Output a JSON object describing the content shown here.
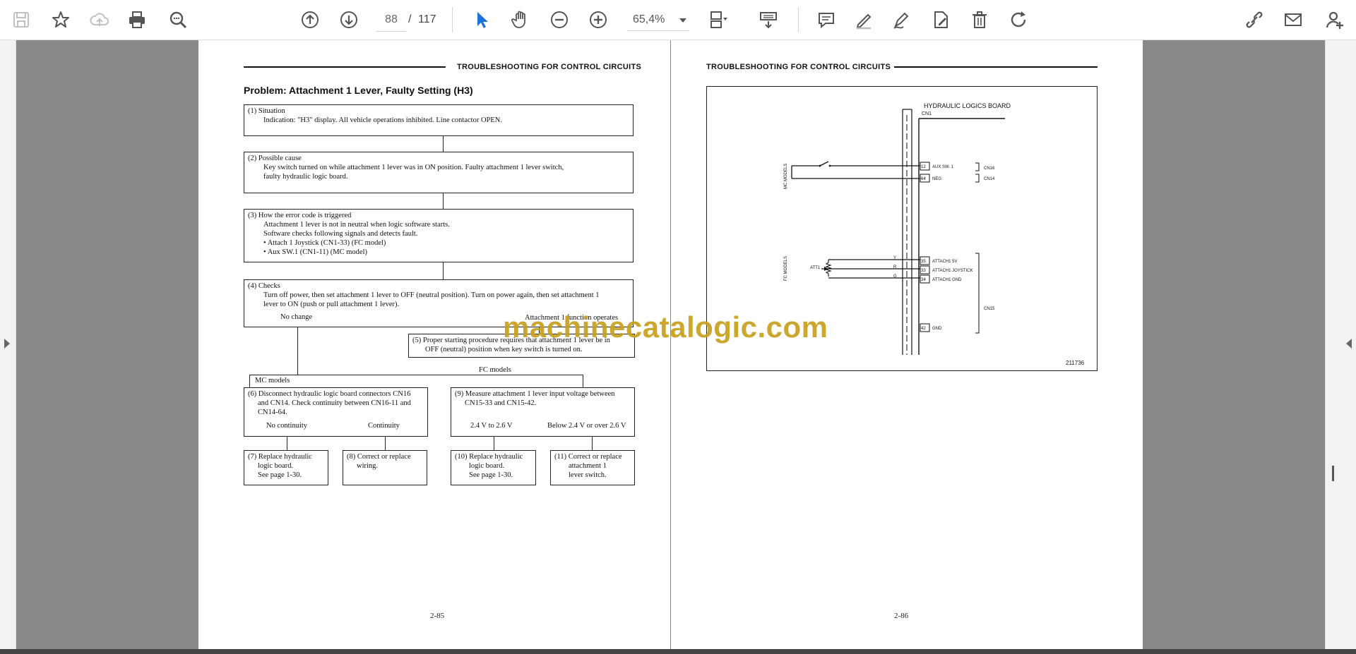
{
  "toolbar": {
    "page_current": "88",
    "page_separator": "/",
    "page_total": "117",
    "zoom": "65,4%",
    "icons": [
      "save-icon",
      "bookmark-star-icon",
      "cloud-upload-icon",
      "print-icon",
      "zoom-search-icon",
      "arrow-up-circle-icon",
      "arrow-down-circle-icon",
      "select-cursor-icon",
      "hand-pan-icon",
      "zoom-out-icon",
      "zoom-in-icon",
      "fit-page-icon",
      "scroll-mode-icon",
      "comment-icon",
      "highlight-pen-icon",
      "draw-pen-icon",
      "fill-sign-icon",
      "delete-icon",
      "rotate-icon",
      "share-link-icon",
      "mail-icon",
      "add-user-icon"
    ]
  },
  "left_page": {
    "header": "TROUBLESHOOTING FOR CONTROL CIRCUITS",
    "title": "Problem: Attachment 1 Lever, Faulty Setting (H3)",
    "box1_title": "(1) Situation",
    "box1_line1": "Indication: \"H3\" display. All vehicle operations inhibited. Line contactor OPEN.",
    "box2_title": "(2) Possible cause",
    "box2_line1": "Key switch turned on while attachment 1 lever was in ON position. Faulty attachment 1 lever switch,",
    "box2_line2": "faulty hydraulic logic board.",
    "box3_title": "(3) How the error code is triggered",
    "box3_line1": "Attachment 1 lever is not in neutral when logic software starts.",
    "box3_line2": "Software checks following signals and detects fault.",
    "box3_line3": "• Attach 1 Joystick (CN1-33) (FC model)",
    "box3_line4": "• Aux SW.1 (CN1-11) (MC model)",
    "box4_title": "(4) Checks",
    "box4_line1": "Turn off power, then set attachment 1 lever to OFF (neutral position). Turn on power again, then set attachment 1",
    "box4_line2": "lever to ON (push or pull attachment 1 lever).",
    "label_nochange": "No change",
    "label_attach_ops": "Attachment 1 function operates",
    "box5_line1": "(5) Proper starting procedure requires that attachment 1 lever be in",
    "box5_line2": "OFF (neutral) position when key switch is turned on.",
    "label_mc": "MC models",
    "label_fc": "FC models",
    "box6_line1": "(6) Disconnect hydraulic logic board connectors CN16",
    "box6_line2": "and CN14. Check continuity between CN16-11 and",
    "box6_line3": "CN14-64.",
    "label_nocont": "No continuity",
    "label_cont": "Continuity",
    "box9_line1": "(9) Measure attachment 1 lever input voltage between",
    "box9_line2": "CN15-33 and CN15-42.",
    "label_v_ok": "2.4 V to 2.6 V",
    "label_v_bad": "Below 2.4 V or over 2.6 V",
    "box7_line1": "(7) Replace hydraulic",
    "box7_line2": "logic board.",
    "box7_line3": "See page 1-30.",
    "box8_line1": "(8) Correct or replace",
    "box8_line2": "wiring.",
    "box10_line1": "(10) Replace hydraulic",
    "box10_line2": "logic board.",
    "box10_line3": "See page 1-30.",
    "box11_line1": "(11) Correct or replace",
    "box11_line2": "attachment 1",
    "box11_line3": "lever switch.",
    "page_number": "2-85"
  },
  "right_page": {
    "header": "TROUBLESHOOTING FOR CONTROL CIRCUITS",
    "diagram": {
      "board_label": "HYDRAULIC LOGICS BOARD",
      "cn1": "CN1",
      "mc_models": "MC MODELS",
      "fc_models": "FC MODELS",
      "pin12": "12",
      "pin64": "64",
      "pin35": "35",
      "pin33": "33",
      "pin34": "34",
      "pin42": "42",
      "aux_sw": "AUX SW. 1",
      "neg": "NEG",
      "cn16": "CN16",
      "cn14": "CN14",
      "cn15": "CN15",
      "att1_5v": "ATTACH1 5V",
      "att1_joy": "ATTACH1 JOYSTICK",
      "att1_gnd": "ATTACH1 GND",
      "gnd": "GND",
      "att1": "ATT1",
      "wire_y": "Y",
      "wire_r": "R",
      "wire_g": "G",
      "fig_id": "211736"
    },
    "page_number": "2-86"
  },
  "watermark": "machinecatalogic.com"
}
